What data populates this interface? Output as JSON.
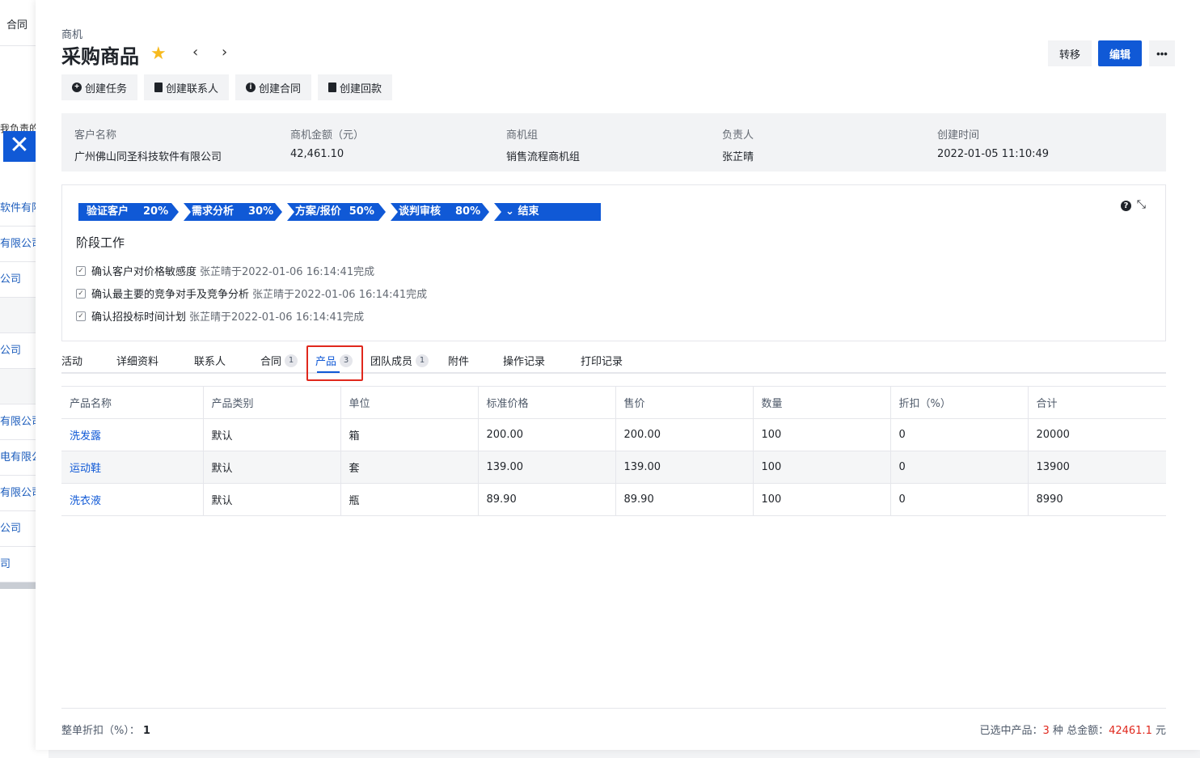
{
  "background": {
    "top_tab": "合同",
    "clip_text": "我负责的",
    "rows": [
      "软件有限",
      "有限公司",
      "公司",
      "",
      "公司",
      "",
      "有限公司",
      "电有限公",
      "有限公司",
      "公司",
      "司"
    ]
  },
  "header": {
    "breadcrumb": "商机",
    "title": "采购商品",
    "transfer_label": "转移",
    "edit_label": "编辑",
    "more_label": "•••"
  },
  "quick_actions": [
    {
      "label": "创建任务"
    },
    {
      "label": "创建联系人"
    },
    {
      "label": "创建合同"
    },
    {
      "label": "创建回款"
    }
  ],
  "info": [
    {
      "label": "客户名称",
      "value": "广州佛山同圣科技软件有限公司"
    },
    {
      "label": "商机金额（元）",
      "value": "42,461.10"
    },
    {
      "label": "商机组",
      "value": "销售流程商机组"
    },
    {
      "label": "负责人",
      "value": "张芷晴"
    },
    {
      "label": "创建时间",
      "value": "2022-01-05 11:10:49"
    }
  ],
  "stages": [
    {
      "name": "验证客户",
      "pct": "20%"
    },
    {
      "name": "需求分析",
      "pct": "30%"
    },
    {
      "name": "方案/报价",
      "pct": "50%"
    },
    {
      "name": "谈判审核",
      "pct": "80%"
    },
    {
      "name": "结束",
      "pct": ""
    }
  ],
  "stage_work": {
    "title": "阶段工作",
    "tasks": [
      {
        "name": "确认客户对价格敏感度",
        "meta": "张芷晴于2022-01-06 16:14:41完成"
      },
      {
        "name": "确认最主要的竞争对手及竞争分析",
        "meta": "张芷晴于2022-01-06 16:14:41完成"
      },
      {
        "name": "确认招投标时间计划",
        "meta": "张芷晴于2022-01-06 16:14:41完成"
      }
    ]
  },
  "tabs": [
    {
      "label": "活动",
      "badge": ""
    },
    {
      "label": "详细资料",
      "badge": ""
    },
    {
      "label": "联系人",
      "badge": ""
    },
    {
      "label": "合同",
      "badge": "1"
    },
    {
      "label": "产品",
      "badge": "3"
    },
    {
      "label": "团队成员",
      "badge": "1"
    },
    {
      "label": "附件",
      "badge": ""
    },
    {
      "label": "操作记录",
      "badge": ""
    },
    {
      "label": "打印记录",
      "badge": ""
    }
  ],
  "table": {
    "headers": [
      "产品名称",
      "产品类别",
      "单位",
      "标准价格",
      "售价",
      "数量",
      "折扣（%）",
      "合计"
    ],
    "rows": [
      [
        "洗发露",
        "默认",
        "箱",
        "200.00",
        "200.00",
        "100",
        "0",
        "20000"
      ],
      [
        "运动鞋",
        "默认",
        "套",
        "139.00",
        "139.00",
        "100",
        "0",
        "13900"
      ],
      [
        "洗衣液",
        "默认",
        "瓶",
        "89.90",
        "89.90",
        "100",
        "0",
        "8990"
      ]
    ]
  },
  "footer": {
    "discount_label": "整单折扣（%）：",
    "discount_value": "1",
    "selected_label": "已选中产品：",
    "selected_count": "3",
    "selected_unit": "种",
    "total_label": "总金额：",
    "total_value": "42461.1",
    "total_unit": "元"
  },
  "colors": {
    "primary": "#1059d6",
    "star": "#f7ba1e",
    "highlight": "#e0281d"
  }
}
